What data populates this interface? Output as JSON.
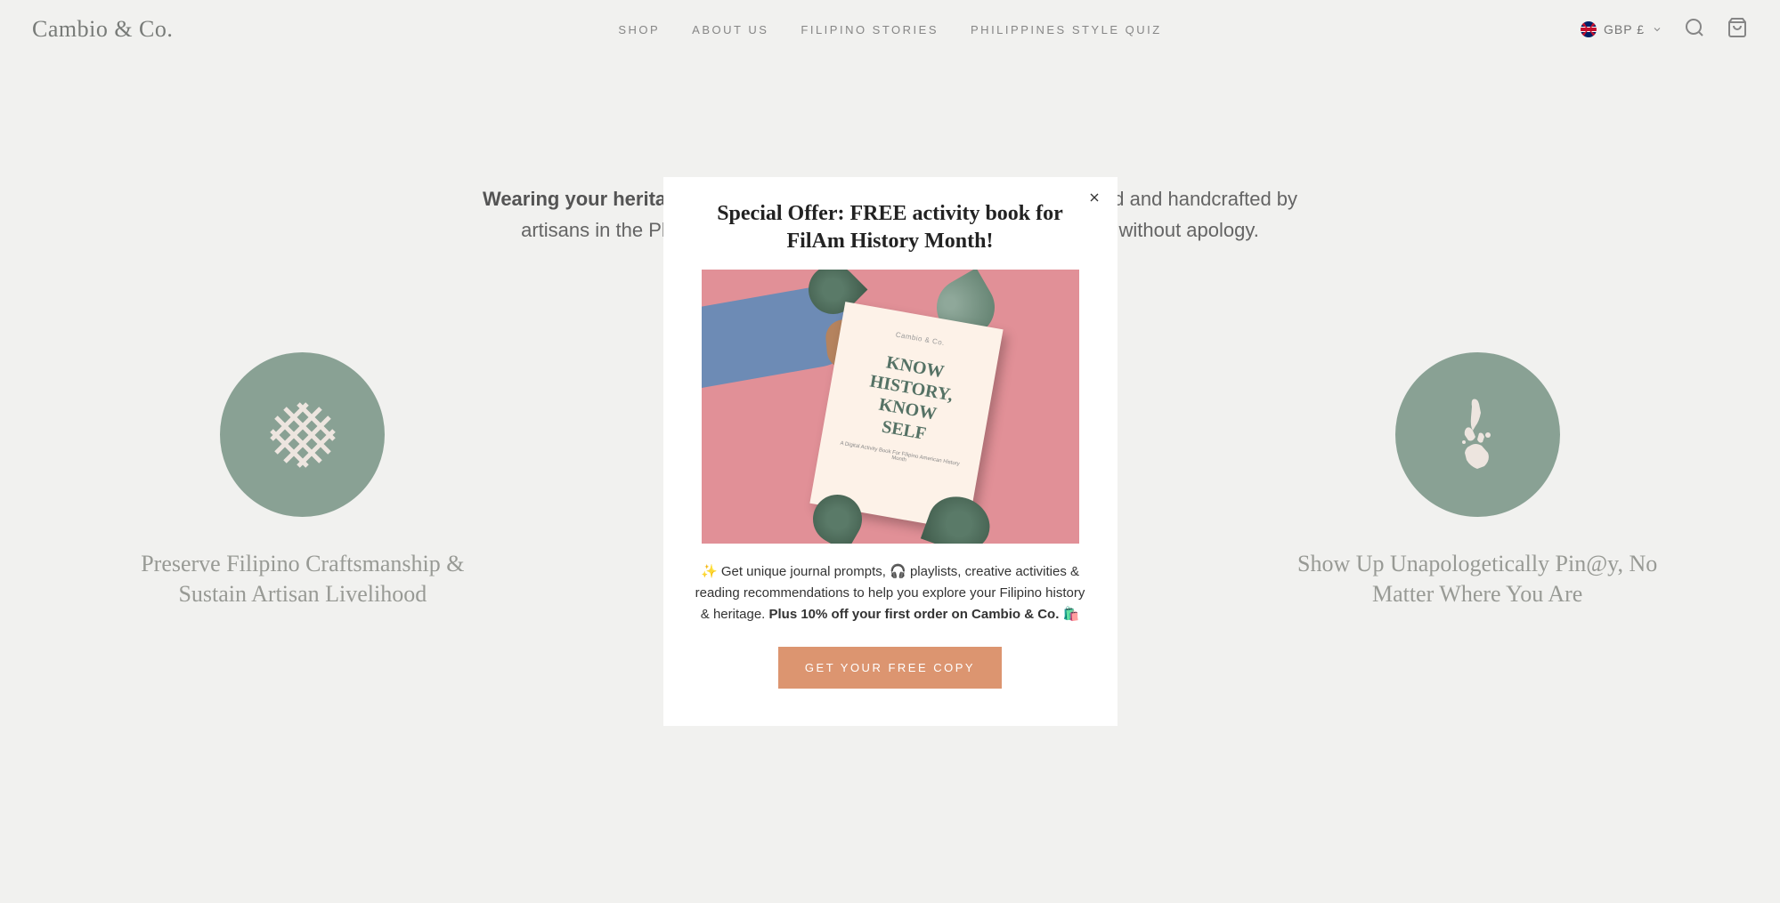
{
  "header": {
    "logo": "Cambio & Co.",
    "nav": [
      {
        "label": "SHOP"
      },
      {
        "label": "ABOUT US"
      },
      {
        "label": "FILIPINO STORIES"
      },
      {
        "label": "PHILIPPINES STYLE QUIZ"
      }
    ],
    "currency": {
      "label": "GBP £"
    }
  },
  "hero": {
    "bold_prefix": "Wearing your heritag",
    "rest": "e proudly. Everything we sell is sustainably sourced and handcrafted by artisans in the Philippines, so you can celebrate your Filipino identity without apology."
  },
  "features": [
    {
      "title": "Preserve Filipino Craftsmanship & Sustain Artisan Livelihood"
    },
    {
      "title": ""
    },
    {
      "title": "Show Up Unapologetically Pin@y, No Matter Where You Are"
    }
  ],
  "modal": {
    "title": "Special Offer: FREE activity book for FilAm History Month!",
    "book_logo": "Cambio & Co.",
    "book_text_1": "KNOW",
    "book_text_2": "HISTORY,",
    "book_text_3": "KNOW",
    "book_text_4": "SELF",
    "book_subtitle": "A Digital Activity Book For Filipino American History Month",
    "desc_prefix": "✨ Get unique journal prompts, 🎧 playlists, creative activities & reading recommendations to help you explore your Filipino history & heritage. ",
    "desc_bold": "Plus 10% off your first order on Cambio & Co. 🛍️",
    "cta": "GET YOUR FREE COPY"
  }
}
